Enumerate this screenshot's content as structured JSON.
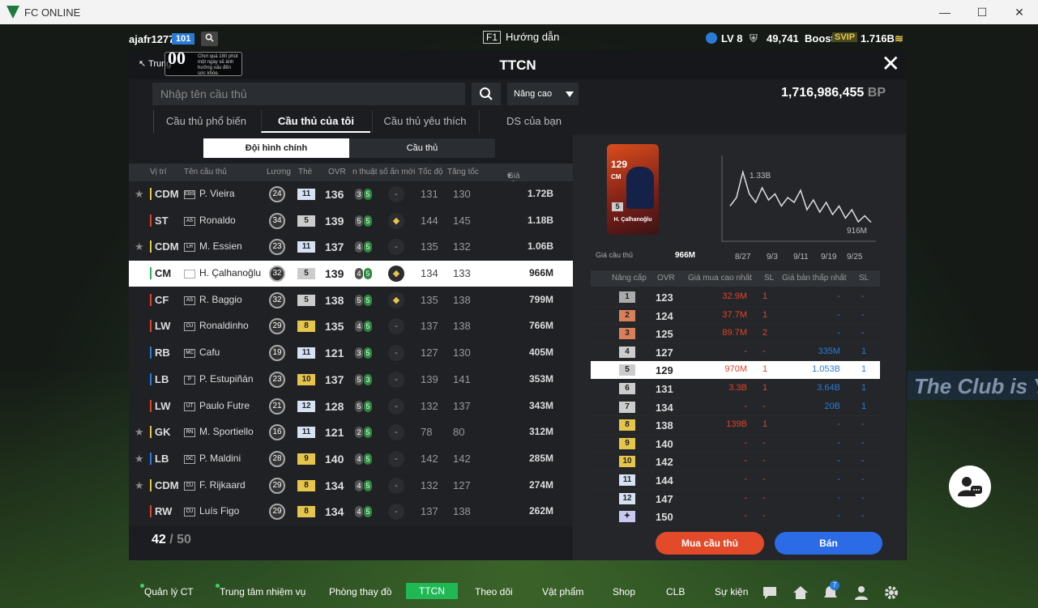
{
  "window": {
    "title": "FC ONLINE"
  },
  "topbar": {
    "username": "ajafr1277",
    "user_level": "101",
    "help_key": "F1",
    "help_label": "Hướng dẫn",
    "lv": "LV 8",
    "points": "49,741",
    "boost": "Boost",
    "svip": "SVIP",
    "bp": "1.716B"
  },
  "panel": {
    "title": "TTCN",
    "back_label": "Trung",
    "age_rating": "00",
    "age_text": "Chơi quá 180 phút một ngày sẽ ảnh hưởng xấu đến sức khỏe.",
    "search_placeholder": "Nhập tên cầu thủ",
    "advanced_label": "Nâng cao",
    "bp_value": "1,716,986,455",
    "bp_unit": "BP",
    "tabs": [
      "Cầu thủ phổ biến",
      "Cầu thủ của tôi",
      "Cầu thủ yêu thích",
      "DS của bạn"
    ],
    "subtabs": [
      "Đội hình chính",
      "Cầu thủ"
    ],
    "columns": [
      "Vị trí",
      "Tên cầu thủ",
      "Lương",
      "Thẻ",
      "OVR",
      "n thuật",
      "số ấn mới",
      "Tốc độ",
      "Tăng tốc",
      "Giá cầu thủ"
    ],
    "players": [
      {
        "star": "★",
        "pos": "CDM",
        "club": "EBS",
        "name": "P. Vieira",
        "pay": "24",
        "grade": "11",
        "ovr": "136",
        "c1": "3",
        "c2": "5",
        "new": "-",
        "spd": "131",
        "acc": "130",
        "price": "1.72B"
      },
      {
        "star": "",
        "pos": "ST",
        "club": "AS",
        "name": "Ronaldo",
        "pay": "34",
        "grade": "5",
        "ovr": "139",
        "c1": "5",
        "c2": "5",
        "new": "◆",
        "spd": "144",
        "acc": "145",
        "price": "1.18B"
      },
      {
        "star": "★",
        "pos": "CDM",
        "club": "LH",
        "name": "M. Essien",
        "pay": "23",
        "grade": "11",
        "ovr": "137",
        "c1": "4",
        "c2": "5",
        "new": "-",
        "spd": "135",
        "acc": "132",
        "price": "1.06B"
      },
      {
        "star": "",
        "pos": "CM",
        "club": "SP",
        "name": "H. Çalhanoğlu",
        "pay": "32",
        "grade": "5",
        "ovr": "139",
        "c1": "4",
        "c2": "5",
        "new": "◆",
        "spd": "134",
        "acc": "133",
        "price": "966M"
      },
      {
        "star": "",
        "pos": "CF",
        "club": "AS",
        "name": "R. Baggio",
        "pay": "32",
        "grade": "5",
        "ovr": "138",
        "c1": "5",
        "c2": "5",
        "new": "◆",
        "spd": "135",
        "acc": "138",
        "price": "799M"
      },
      {
        "star": "",
        "pos": "LW",
        "club": "CU",
        "name": "Ronaldinho",
        "pay": "29",
        "grade": "8",
        "ovr": "135",
        "c1": "4",
        "c2": "5",
        "new": "-",
        "spd": "137",
        "acc": "138",
        "price": "766M"
      },
      {
        "star": "",
        "pos": "RB",
        "club": "MC",
        "name": "Cafu",
        "pay": "19",
        "grade": "11",
        "ovr": "121",
        "c1": "3",
        "c2": "5",
        "new": "-",
        "spd": "127",
        "acc": "130",
        "price": "405M"
      },
      {
        "star": "",
        "pos": "LB",
        "club": "P",
        "name": "P. Estupiñán",
        "pay": "23",
        "grade": "10",
        "ovr": "137",
        "c1": "5",
        "c2": "3",
        "new": "-",
        "spd": "139",
        "acc": "141",
        "price": "353M"
      },
      {
        "star": "",
        "pos": "LW",
        "club": "UT",
        "name": "Paulo Futre",
        "pay": "21",
        "grade": "12",
        "ovr": "128",
        "c1": "5",
        "c2": "5",
        "new": "-",
        "spd": "132",
        "acc": "137",
        "price": "343M"
      },
      {
        "star": "★",
        "pos": "GK",
        "club": "RN",
        "name": "M. Sportiello",
        "pay": "16",
        "grade": "11",
        "ovr": "121",
        "c1": "2",
        "c2": "5",
        "new": "-",
        "spd": "78",
        "acc": "80",
        "price": "312M"
      },
      {
        "star": "★",
        "pos": "LB",
        "club": "DC",
        "name": "P. Maldini",
        "pay": "28",
        "grade": "9",
        "ovr": "140",
        "c1": "4",
        "c2": "5",
        "new": "-",
        "spd": "142",
        "acc": "142",
        "price": "285M"
      },
      {
        "star": "★",
        "pos": "CDM",
        "club": "CU",
        "name": "F. Rijkaard",
        "pay": "29",
        "grade": "8",
        "ovr": "134",
        "c1": "4",
        "c2": "5",
        "new": "-",
        "spd": "132",
        "acc": "127",
        "price": "274M"
      },
      {
        "star": "",
        "pos": "RW",
        "club": "CU",
        "name": "Luís Figo",
        "pay": "29",
        "grade": "8",
        "ovr": "134",
        "c1": "4",
        "c2": "5",
        "new": "-",
        "spd": "137",
        "acc": "138",
        "price": "262M"
      }
    ],
    "count_current": "42",
    "count_sep": "/",
    "count_max": "50"
  },
  "detail": {
    "card_ovr": "129",
    "card_pos": "CM",
    "card_grade": "5",
    "card_name": "H. Çalhanoğlu",
    "price_caption": "Giá cầu thủ",
    "price_value": "966M",
    "graph_max_label": "1.33B",
    "graph_last_label": "916M",
    "graph_dates": [
      "8/27",
      "9/3",
      "9/11",
      "9/19",
      "9/25"
    ],
    "graph_points": [
      1.05,
      1.12,
      1.33,
      1.15,
      1.08,
      1.2,
      1.1,
      1.15,
      1.05,
      1.12,
      1.08,
      1.18,
      1.02,
      1.1,
      1.0,
      1.08,
      0.98,
      1.05,
      0.95,
      1.02,
      0.92,
      0.97,
      0.916
    ],
    "upgrade_columns": [
      "Nâng cấp",
      "OVR",
      "Giá mua cao nhất",
      "SL",
      "Giá bán thấp nhất",
      "SL"
    ],
    "upgrades": [
      {
        "lv": "1",
        "ovr": "123",
        "buy": "32.9M",
        "bsl": "1",
        "sell": "-",
        "ssl": "-"
      },
      {
        "lv": "2",
        "ovr": "124",
        "buy": "37.7M",
        "bsl": "1",
        "sell": "-",
        "ssl": "-"
      },
      {
        "lv": "3",
        "ovr": "125",
        "buy": "89.7M",
        "bsl": "2",
        "sell": "-",
        "ssl": "-"
      },
      {
        "lv": "4",
        "ovr": "127",
        "buy": "-",
        "bsl": "-",
        "sell": "335M",
        "ssl": "1"
      },
      {
        "lv": "5",
        "ovr": "129",
        "buy": "970M",
        "bsl": "1",
        "sell": "1.053B",
        "ssl": "1"
      },
      {
        "lv": "6",
        "ovr": "131",
        "buy": "3.3B",
        "bsl": "1",
        "sell": "3.64B",
        "ssl": "1"
      },
      {
        "lv": "7",
        "ovr": "134",
        "buy": "-",
        "bsl": "-",
        "sell": "20B",
        "ssl": "1"
      },
      {
        "lv": "8",
        "ovr": "138",
        "buy": "139B",
        "bsl": "1",
        "sell": "-",
        "ssl": "-"
      },
      {
        "lv": "9",
        "ovr": "140",
        "buy": "-",
        "bsl": "-",
        "sell": "-",
        "ssl": "-"
      },
      {
        "lv": "10",
        "ovr": "142",
        "buy": "-",
        "bsl": "-",
        "sell": "-",
        "ssl": "-"
      },
      {
        "lv": "11",
        "ovr": "144",
        "buy": "-",
        "bsl": "-",
        "sell": "-",
        "ssl": "-"
      },
      {
        "lv": "12",
        "ovr": "147",
        "buy": "-",
        "bsl": "-",
        "sell": "-",
        "ssl": "-"
      },
      {
        "lv": "✦",
        "ovr": "150",
        "buy": "-",
        "bsl": "-",
        "sell": "-",
        "ssl": "-"
      }
    ],
    "buy_label": "Mua cầu thủ",
    "sell_label": "Bán"
  },
  "bottombar": {
    "items": [
      "Quản lý CT",
      "Trung tâm nhiệm vụ",
      "Phòng thay đồ",
      "TTCN",
      "Theo dõi",
      "Vật phẩm",
      "Shop",
      "CLB",
      "Sự kiện"
    ],
    "notif_count": "7"
  },
  "background": {
    "banner_text": "The Club is Y"
  },
  "colors": {
    "accent_green": "#1fb854",
    "buy_red": "#e24a2a",
    "sell_blue": "#2b6be6",
    "selected_row": "#ffffff"
  }
}
